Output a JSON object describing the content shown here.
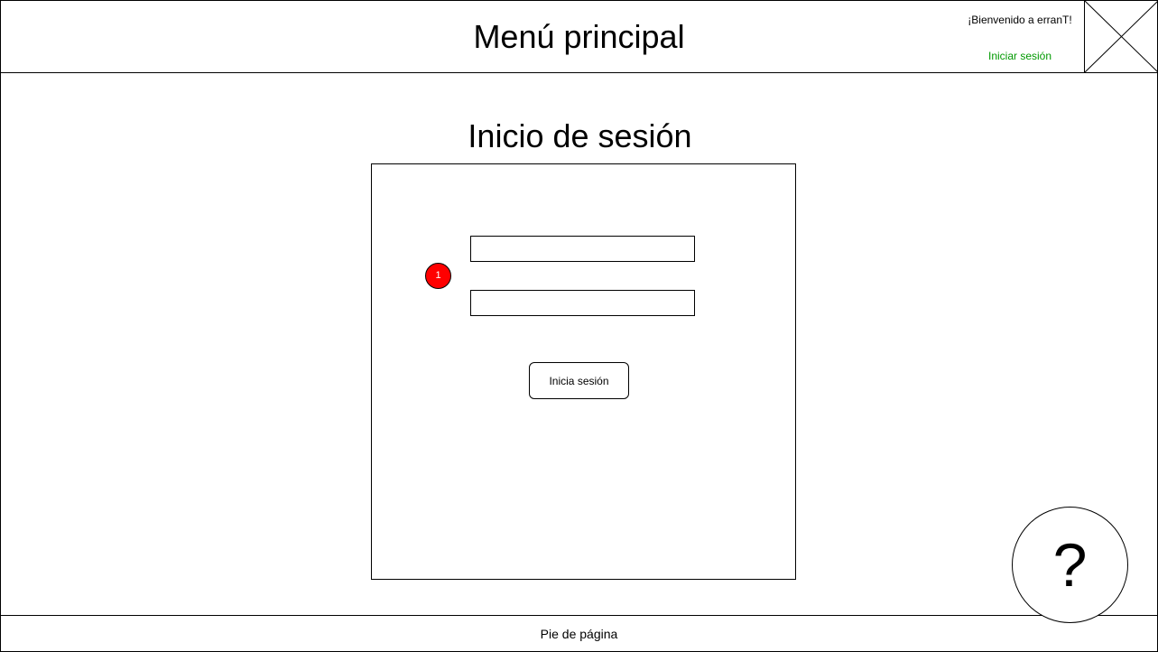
{
  "header": {
    "title": "Menú principal",
    "welcome": "¡Bienvenido a erranT!",
    "login_link": "Iniciar sesión",
    "logo": "image-placeholder-icon"
  },
  "main": {
    "title": "Inicio de sesión",
    "form": {
      "username_value": "",
      "password_value": "",
      "marker": "1",
      "submit_label": "Inicia sesión"
    },
    "help_button": "?"
  },
  "footer": {
    "text": "Pie de página"
  },
  "colors": {
    "link": "#009900",
    "marker": "#ff0000"
  }
}
